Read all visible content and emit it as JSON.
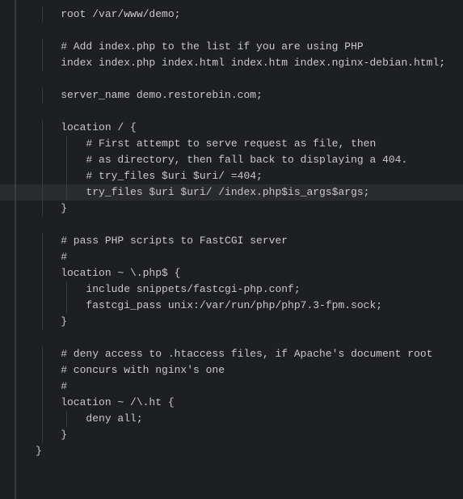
{
  "code": {
    "lines": [
      "    root /var/www/demo;",
      "",
      "    # Add index.php to the list if you are using PHP",
      "    index index.php index.html index.htm index.nginx-debian.html;",
      "",
      "    server_name demo.restorebin.com;",
      "",
      "    location / {",
      "        # First attempt to serve request as file, then",
      "        # as directory, then fall back to displaying a 404.",
      "        # try_files $uri $uri/ =404;",
      "        try_files $uri $uri/ /index.php$is_args$args;",
      "    }",
      "",
      "    # pass PHP scripts to FastCGI server",
      "    #",
      "    location ~ \\.php$ {",
      "        include snippets/fastcgi-php.conf;",
      "        fastcgi_pass unix:/var/run/php/php7.3-fpm.sock;",
      "    }",
      "",
      "    # deny access to .htaccess files, if Apache's document root",
      "    # concurs with nginx's one",
      "    #",
      "    location ~ /\\.ht {",
      "        deny all;",
      "    }",
      "}"
    ],
    "highlighted_line_index": 11
  },
  "colors": {
    "background": "#1e1f22",
    "text": "#c9c9c9",
    "guide": "#3a3b3f"
  }
}
